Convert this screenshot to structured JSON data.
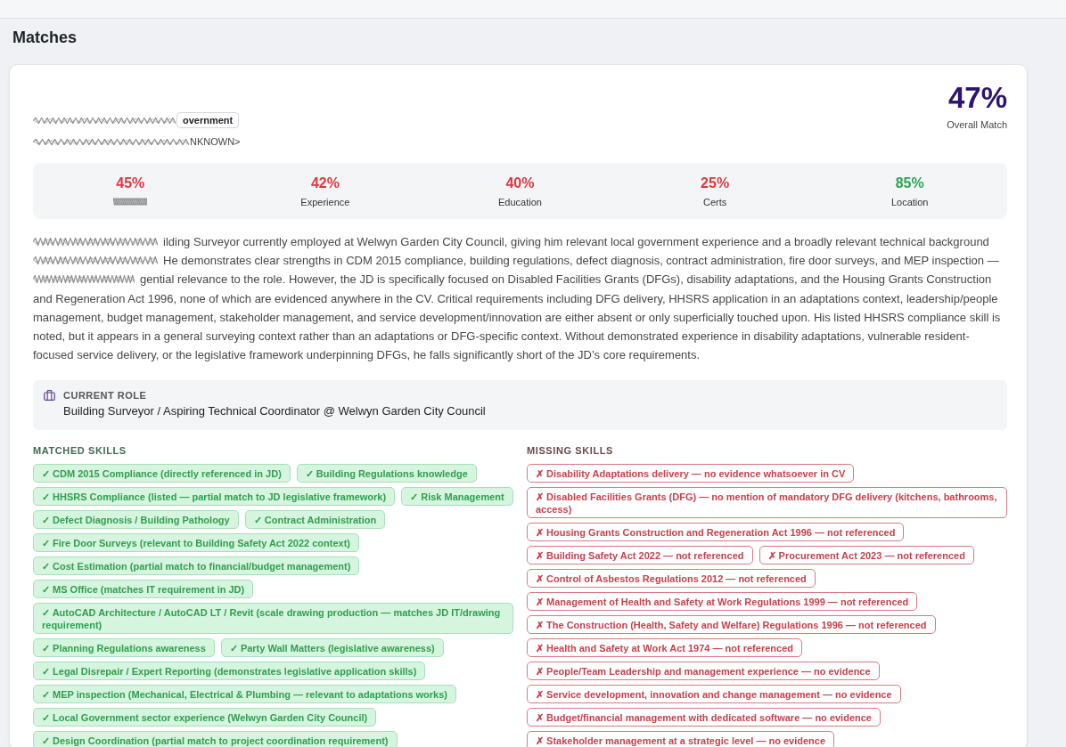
{
  "page": {
    "title": "Matches"
  },
  "match_card": {
    "candidate": {
      "badge": {
        "text": "overnment",
        "redacted_before": true
      },
      "subtitle": {
        "text": "NKNOWN>",
        "redacted_before": true
      }
    },
    "overall": {
      "value": "47%",
      "label": "Overall Match"
    },
    "scores": [
      {
        "value": "45%",
        "label_redacted": true,
        "color": "#dc3a3f"
      },
      {
        "value": "42%",
        "label": "Experience",
        "label_redacted": false,
        "color": "#dc3a3f"
      },
      {
        "value": "40%",
        "label": "Education",
        "label_redacted": false,
        "color": "#dc3a3f"
      },
      {
        "value": "25%",
        "label": "Certs",
        "label_redacted": false,
        "color": "#dc3a3f"
      },
      {
        "value": "85%",
        "label": "Location",
        "label_redacted": false,
        "color": "#28a64f"
      }
    ],
    "summary": [
      {
        "redacted_before": true,
        "text": "ilding Surveyor currently employed at Welwyn Garden City Council, giving him relevant local government experience and a broadly relevant technical background"
      },
      {
        "redacted_before": true,
        "text": "He demonstrates clear strengths in CDM 2015 compliance, building regulations, defect diagnosis, contract administration, fire door surveys, and MEP inspection —"
      },
      {
        "redacted_before": true,
        "text": "gential relevance to the role. However, the JD is specifically focused on Disabled Facilities Grants (DFGs), disability adaptations, and the Housing Grants Construction and Regeneration Act 1996, none of which are evidenced anywhere in the CV. Critical requirements including DFG delivery, HHSRS application in an adaptations context, leadership/people management, budget management, stakeholder management, and service development/innovation are either absent or only superficially touched upon. His listed HHSRS compliance skill is noted, but it appears in a general surveying context rather than an adaptations or DFG-specific context. Without demonstrated experience in disability adaptations, vulnerable resident-focused service delivery, or the legislative framework underpinning DFGs, he falls significantly short of the JD’s core requirements."
      }
    ],
    "current_role": {
      "label": "CURRENT ROLE",
      "text": "Building Surveyor / Aspiring Technical Coordinator @ Welwyn Garden City Council"
    },
    "skill_groups": [
      {
        "kind": "matched",
        "title": "MATCHED SKILLS",
        "items": [
          "✓ CDM 2015 Compliance (directly referenced in JD)",
          "✓ Building Regulations knowledge",
          "✓ HHSRS Compliance (listed — partial match to JD legislative framework)",
          "✓ Risk Management",
          "✓ Defect Diagnosis / Building Pathology",
          "✓ Contract Administration",
          "✓ Fire Door Surveys (relevant to Building Safety Act 2022 context)",
          "✓ Cost Estimation (partial match to financial/budget management)",
          "✓ MS Office (matches IT requirement in JD)",
          "✓ AutoCAD Architecture / AutoCAD LT / Revit (scale drawing production — matches JD IT/drawing requirement)",
          "✓ Planning Regulations awareness",
          "✓ Party Wall Matters (legislative awareness)",
          "✓ Legal Disrepair / Expert Reporting (demonstrates legislative application skills)",
          "✓ MEP inspection (Mechanical, Electrical & Plumbing — relevant to adaptations works)",
          "✓ Local Government sector experience (Welwyn Garden City Council)",
          "✓ Design Coordination (partial match to project coordination requirement)"
        ]
      },
      {
        "kind": "missing",
        "title": "MISSING SKILLS",
        "items": [
          "✗ Disability Adaptations delivery — no evidence whatsoever in CV",
          "✗ Disabled Facilities Grants (DFG) — no mention of mandatory DFG delivery (kitchens, bathrooms, access)",
          "✗ Housing Grants Construction and Regeneration Act 1996 — not referenced",
          "✗ Building Safety Act 2022 — not referenced",
          "✗ Procurement Act 2023 — not referenced",
          "✗ Control of Asbestos Regulations 2012 — not referenced",
          "✗ Management of Health and Safety at Work Regulations 1999 — not referenced",
          "✗ The Construction (Health, Safety and Welfare) Regulations 1996 — not referenced",
          "✗ Health and Safety at Work Act 1974 — not referenced",
          "✗ People/Team Leadership and management experience — no evidence",
          "✗ Service development, innovation and change management — no evidence",
          "✗ Budget/financial management with dedicated software — no evidence",
          "✗ Stakeholder management at a strategic level — no evidence"
        ]
      }
    ]
  }
}
